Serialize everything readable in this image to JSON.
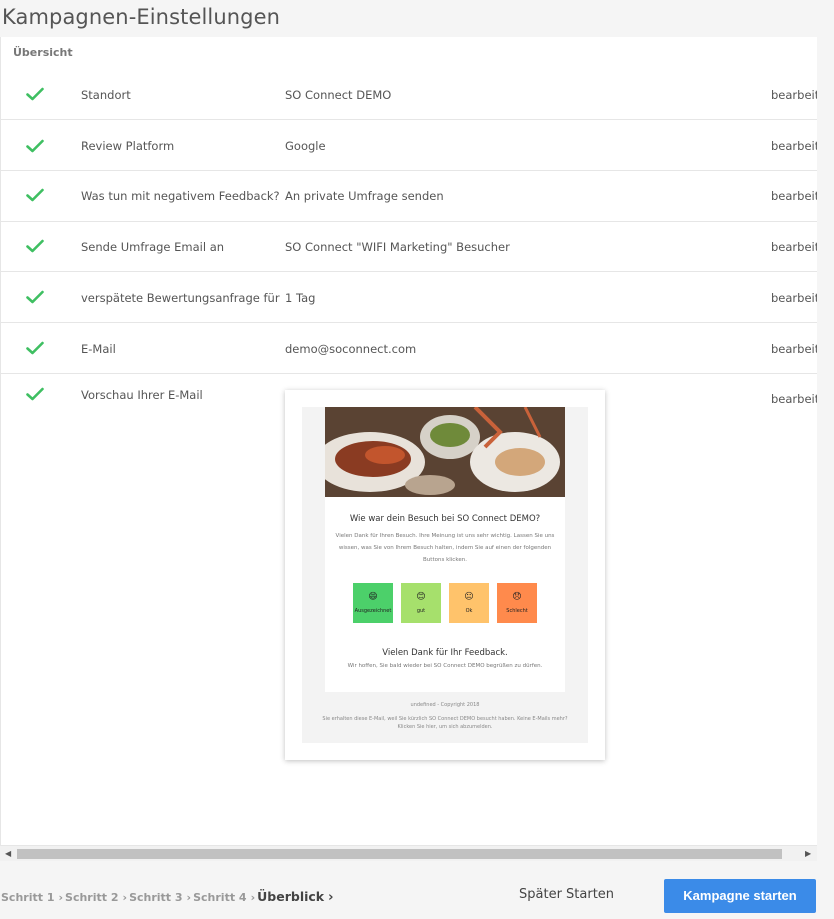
{
  "page_title": "Kampagnen-Einstellungen",
  "section_label": "Übersicht",
  "accent_color": "#3b8be8",
  "check_color": "#3fbf62",
  "rows": [
    {
      "label": "Standort",
      "value": "SO Connect DEMO",
      "edit": "bearbeiten"
    },
    {
      "label": "Review Platform",
      "value": "Google",
      "edit": "bearbeiten"
    },
    {
      "label": "Was tun mit negativem Feedback?",
      "value": "An private Umfrage senden",
      "edit": "bearbeiten"
    },
    {
      "label": "Sende Umfrage Email an",
      "value": "SO Connect \"WIFI Marketing\" Besucher",
      "edit": "bearbeiten"
    },
    {
      "label": "verspätete Bewertungsanfrage für",
      "value": "1 Tag",
      "edit": "bearbeiten"
    },
    {
      "label": "E-Mail",
      "value": "demo@soconnect.com",
      "edit": "bearbeiten"
    },
    {
      "label": "Vorschau Ihrer E-Mail",
      "value": "",
      "edit": "bearbeiten"
    }
  ],
  "email_preview": {
    "question": "Wie war dein Besuch bei SO Connect DEMO?",
    "intro": "Vielen Dank für Ihren Besuch. Ihre Meinung ist uns sehr wichtig. Lassen Sie uns wissen, was Sie von Ihrem Besuch halten, indem Sie auf einen der folgenden Buttons klicken.",
    "buttons": [
      {
        "label": "Ausgezeichnet",
        "emoji": "😄",
        "color": "#4cd06a"
      },
      {
        "label": "gut",
        "emoji": "😊",
        "color": "#a6e06c"
      },
      {
        "label": "Ok",
        "emoji": "😐",
        "color": "#ffc36b"
      },
      {
        "label": "Schlecht",
        "emoji": "😞",
        "color": "#ff8a4c"
      }
    ],
    "thanks": "Vielen Dank für Ihr Feedback.",
    "thanks_sub": "Wir hoffen, Sie bald wieder bei SO Connect DEMO begrüßen zu dürfen.",
    "copyright": "undefined - Copyright 2018",
    "footer_note": "Sie erhalten diese E-Mail, weil Sie kürzlich SO Connect DEMO besucht haben. Keine E-Mails mehr? Klicken Sie hier, um sich abzumelden."
  },
  "footer": {
    "steps": [
      "Schritt 1",
      "Schritt 2",
      "Schritt 3",
      "Schritt 4"
    ],
    "current_step": "Überblick",
    "later_label": "Später Starten",
    "start_label": "Kampagne starten"
  }
}
